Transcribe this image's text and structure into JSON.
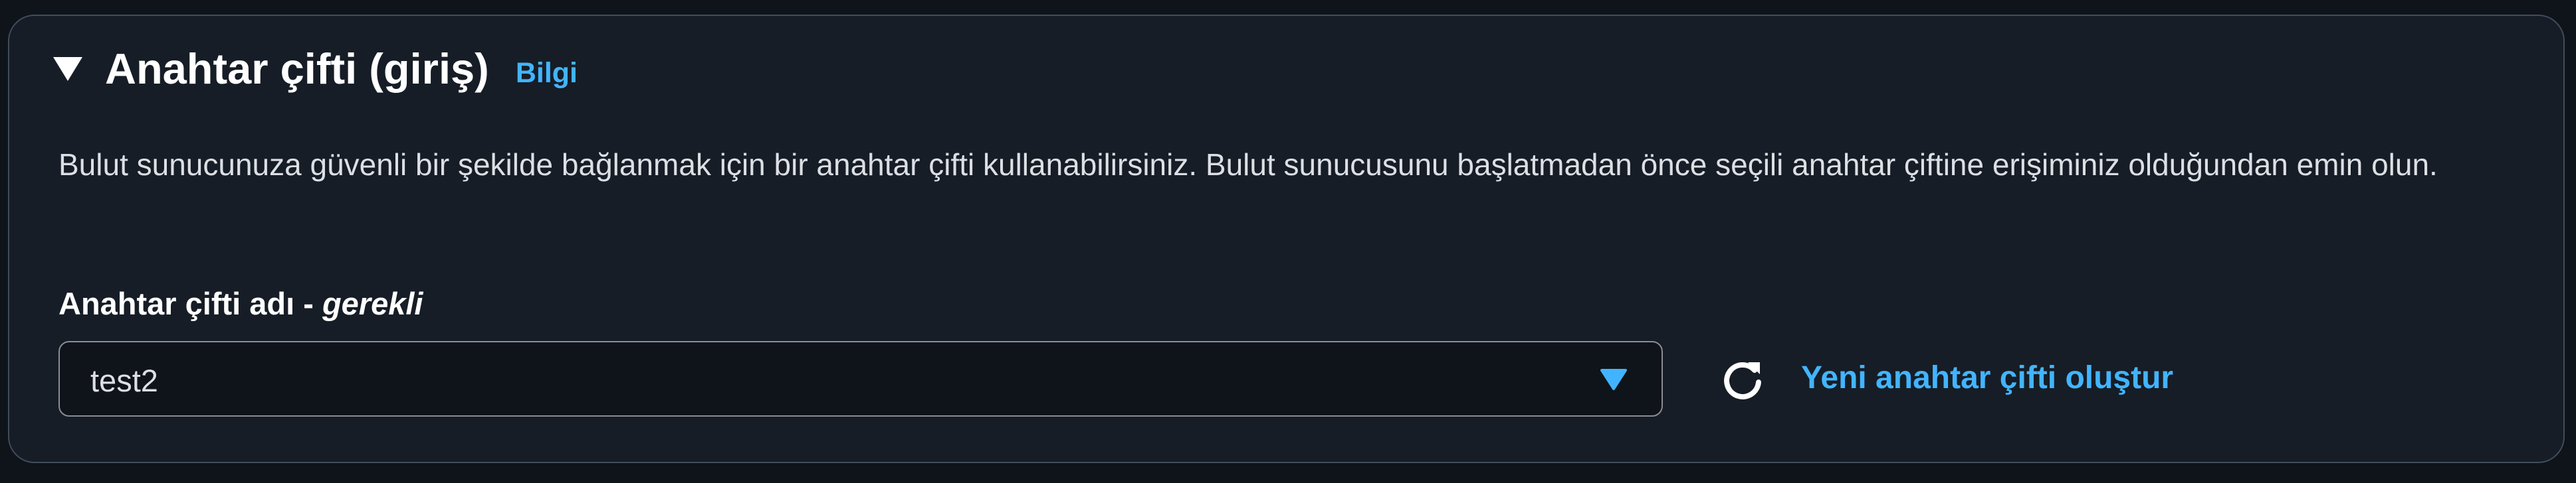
{
  "section": {
    "title": "Anahtar çifti (giriş)",
    "info_link": "Bilgi",
    "description": "Bulut sunucunuza güvenli bir şekilde bağlanmak için bir anahtar çifti kullanabilirsiniz. Bulut sunucusunu başlatmadan önce seçili anahtar çiftine erişiminiz olduğundan emin olun.",
    "expanded": true
  },
  "key_pair_field": {
    "label": "Anahtar çifti adı - ",
    "required_label": "gerekli",
    "selected_value": "test2"
  },
  "actions": {
    "refresh_icon": "refresh-icon",
    "create_link": "Yeni anahtar çifti oluştur"
  },
  "colors": {
    "background": "#0f141a",
    "panel": "#161d26",
    "accent_link": "#42b4ff",
    "text": "#dcdfe4"
  }
}
